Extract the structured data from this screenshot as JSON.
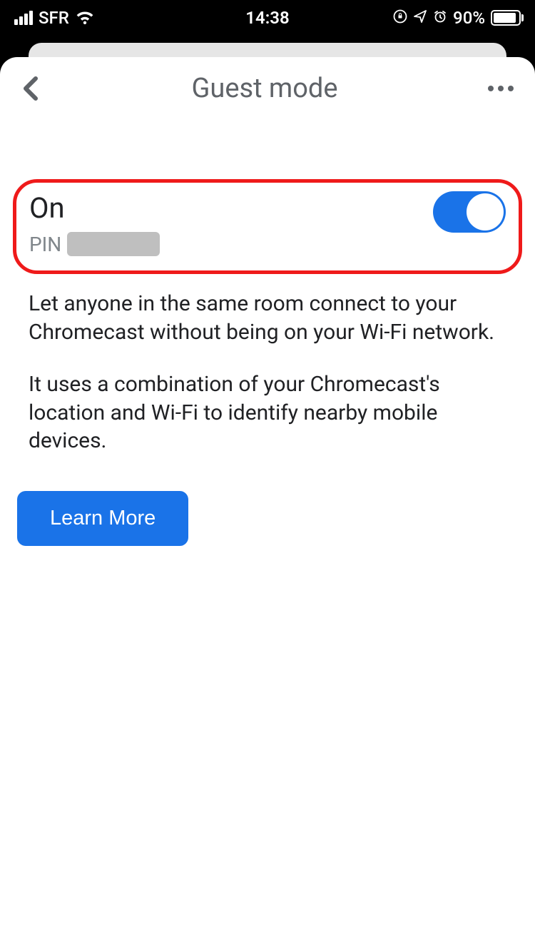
{
  "status": {
    "carrier": "SFR",
    "time": "14:38",
    "battery_pct": "90%",
    "battery_fill_pct": 90
  },
  "header": {
    "title": "Guest mode"
  },
  "toggle": {
    "state_label": "On",
    "pin_label": "PIN",
    "on": true
  },
  "description": {
    "p1": "Let anyone in the same room connect to your Chromecast without being on your Wi-Fi network.",
    "p2": "It uses a combination of your Chromecast's location and Wi-Fi to identify nearby mobile devices."
  },
  "buttons": {
    "learn_more": "Learn More"
  },
  "colors": {
    "accent": "#1a73e8",
    "highlight_border": "#ef1a1a"
  }
}
